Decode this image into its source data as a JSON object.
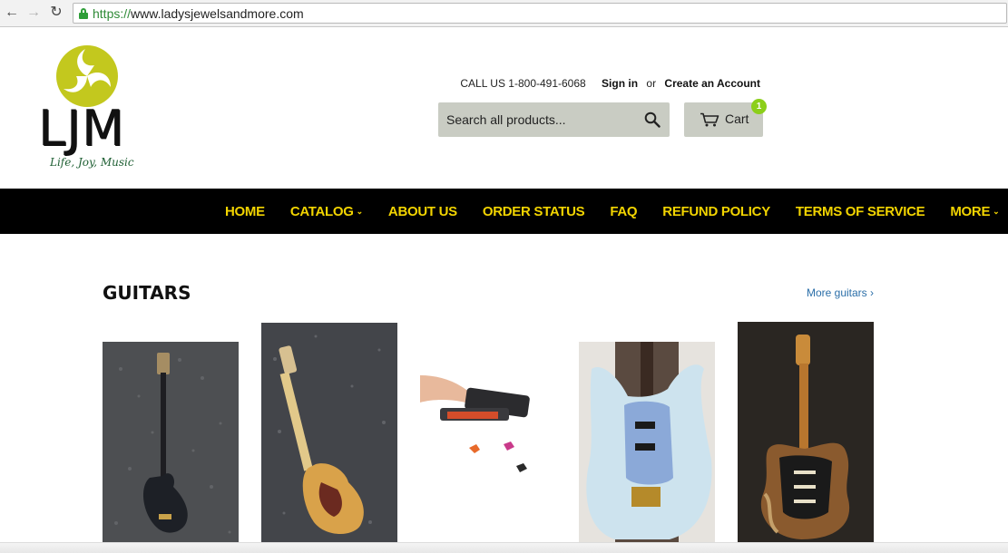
{
  "browser": {
    "url_scheme": "https://",
    "url_rest": "www.ladysjewelsandmore.com",
    "back_icon": "arrow-left",
    "forward_icon": "arrow-right",
    "reload_icon": "reload"
  },
  "logo": {
    "wordmark": "LJM",
    "tagline": "Life, Joy, Music",
    "emblem_color": "#c3c81e"
  },
  "header": {
    "phone": "CALL US 1-800-491-6068",
    "sign_in": "Sign in",
    "or": "or",
    "create_account": "Create an Account"
  },
  "search": {
    "placeholder": "Search all products..."
  },
  "cart": {
    "label": "Cart",
    "count": "1",
    "badge_color": "#8ccf1a"
  },
  "nav": {
    "items": [
      {
        "label": "HOME",
        "dropdown": false
      },
      {
        "label": "CATALOG",
        "dropdown": true
      },
      {
        "label": "ABOUT US",
        "dropdown": false
      },
      {
        "label": "ORDER STATUS",
        "dropdown": false
      },
      {
        "label": "FAQ",
        "dropdown": false
      },
      {
        "label": "REFUND POLICY",
        "dropdown": false
      },
      {
        "label": "TERMS OF SERVICE",
        "dropdown": false
      },
      {
        "label": "MORE",
        "dropdown": true
      }
    ],
    "text_color": "#f2d400",
    "bg_color": "#000000"
  },
  "collection": {
    "title": "GUITARS",
    "more_link": "More guitars ›",
    "products": [
      {
        "image": "black bass guitar"
      },
      {
        "image": "natural telecaster guitar"
      },
      {
        "image": "guitar pick punch"
      },
      {
        "image": "light blue electric guitar"
      },
      {
        "image": "relic stratocaster SRV"
      }
    ]
  }
}
